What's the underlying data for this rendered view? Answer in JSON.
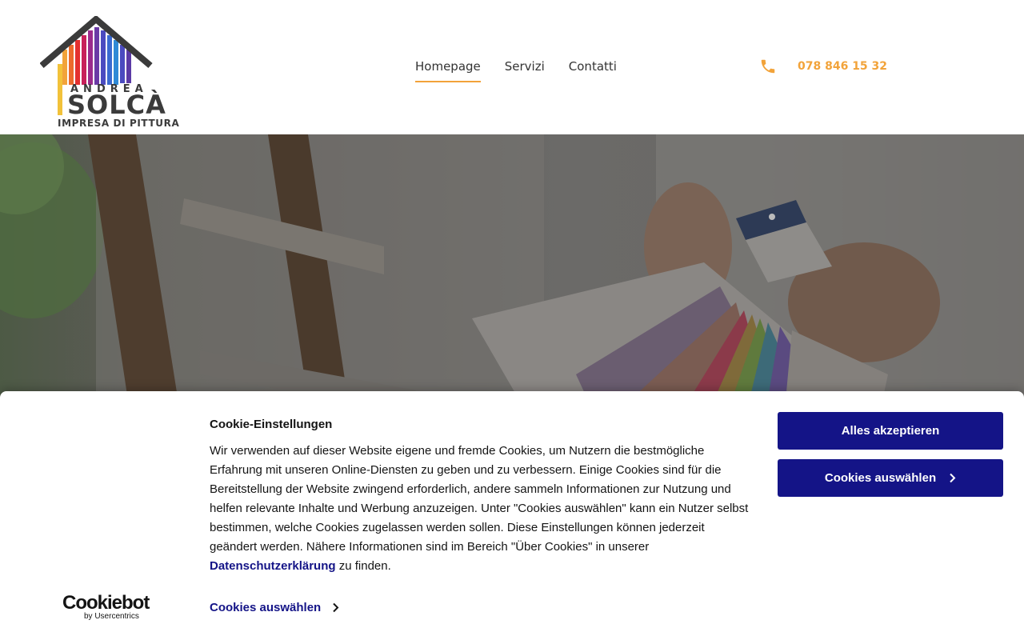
{
  "logo": {
    "top_line": "ANDREA",
    "name": "SOLCÀ",
    "subtitle": "IMPRESA DI PITTURA"
  },
  "nav": {
    "items": [
      {
        "label": "Homepage",
        "active": true
      },
      {
        "label": "Servizi",
        "active": false
      },
      {
        "label": "Contatti",
        "active": false
      }
    ]
  },
  "phone": {
    "icon": "phone-icon",
    "number": "078 846 15 32"
  },
  "colors": {
    "accent": "#f2a33a",
    "cookie_primary": "#141487",
    "logo_dark": "#3b3b3b"
  },
  "cookie": {
    "title": "Cookie-Einstellungen",
    "text_before_link": "Wir verwenden auf dieser Website eigene und fremde Cookies, um Nutzern die bestmögliche Erfahrung mit unseren Online-Diensten zu geben und zu verbessern. Einige Cookies sind für die Bereitstellung der Website zwingend erforderlich, andere sammeln Informationen zur Nutzung und helfen relevante Inhalte und Werbung anzuzeigen. Unter \"Cookies auswählen\" kann ein Nutzer selbst bestimmen, welche Cookies zugelassen werden sollen. Diese Einstellungen können jederzeit geändert werden. Nähere Informationen sind im Bereich \"Über Cookies\" in unserer ",
    "link_text": "Datenschutzerklärung",
    "text_after_link": " zu finden.",
    "accept_all_label": "Alles akzeptieren",
    "select_cookies_label": "Cookies auswählen",
    "select_cookies_link_label": "Cookies auswählen",
    "brand_word": "Cookiebot",
    "brand_by": "by Usercentrics"
  }
}
